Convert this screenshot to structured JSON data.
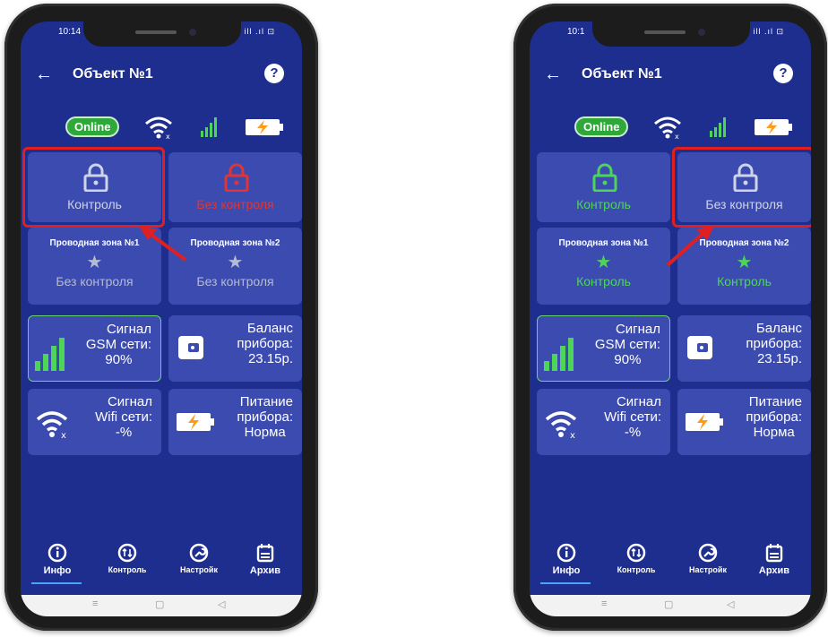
{
  "status_bar": {
    "left_time": "10:14",
    "right_time": "10:1",
    "icons": "ill .ıl ⊡"
  },
  "app": {
    "title": "Объект №1",
    "help_label": "?"
  },
  "status": {
    "online_label": "Online"
  },
  "left": {
    "control_tile": {
      "label": "Контроль",
      "color": "#cfd3ea"
    },
    "no_control_tile": {
      "label": "Без контроля",
      "color": "#e03535"
    },
    "zone1": {
      "title": "Проводная зона №1",
      "state": "Без контроля"
    },
    "zone2": {
      "title": "Проводная зона №2",
      "state": "Без контроля"
    }
  },
  "right": {
    "control_tile": {
      "label": "Контроль",
      "color": "#4fd45a"
    },
    "no_control_tile": {
      "label": "Без контроля",
      "color": "#cfd3ea"
    },
    "zone1": {
      "title": "Проводная зона №1",
      "state": "Контроль"
    },
    "zone2": {
      "title": "Проводная зона №2",
      "state": "Контроль"
    }
  },
  "info": {
    "gsm": {
      "line1": "Сигнал",
      "line2": "GSM сети:",
      "line3": "90%"
    },
    "balance": {
      "line1": "Баланс",
      "line2": "прибора:",
      "line3": "23.15р."
    },
    "wifi": {
      "line1": "Сигнал",
      "line2": "Wifi сети:",
      "line3": "-%"
    },
    "power": {
      "line1": "Питание",
      "line2": "прибора:",
      "line3": "Норма"
    }
  },
  "nav": {
    "info": "Инфо",
    "control": "Контроль",
    "settings": "Настройк",
    "archive": "Архив"
  },
  "system_bar": {
    "menu": "≡",
    "home": "▢",
    "back": "◁"
  },
  "colors": {
    "screen_bg": "#1e2e8e",
    "tile_bg": "#3b4bb0",
    "highlight": "#e02020",
    "online": "#2fa83a"
  }
}
